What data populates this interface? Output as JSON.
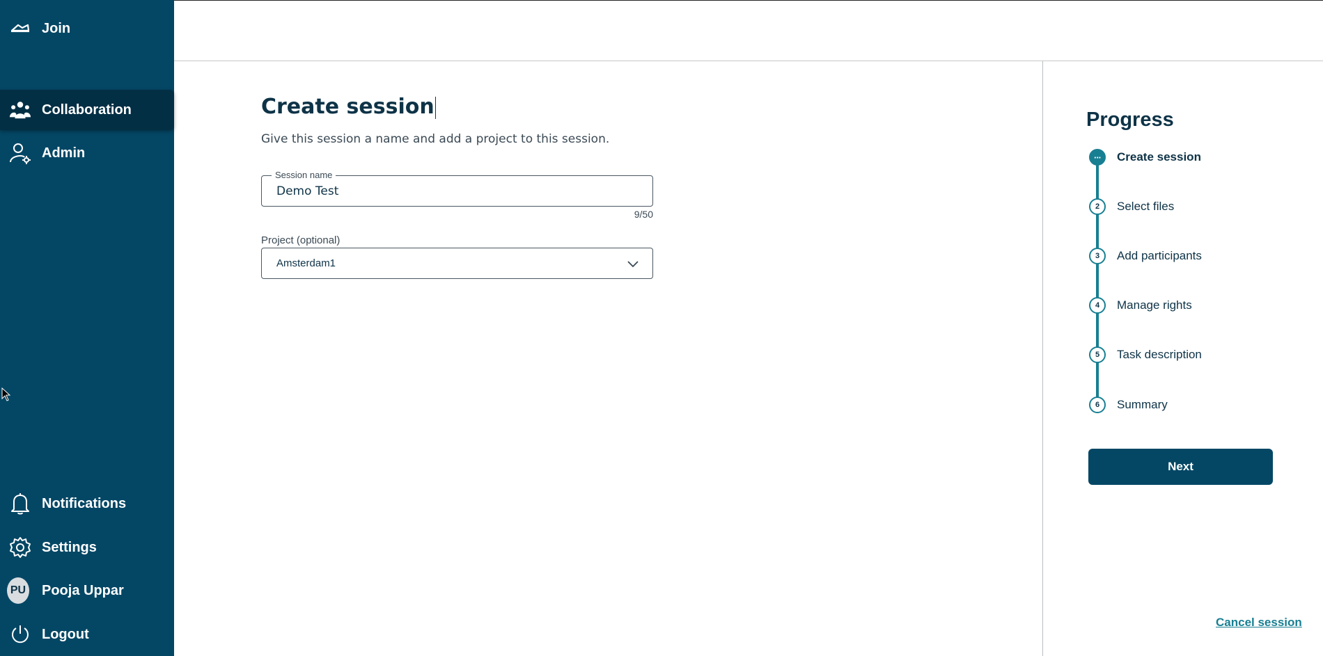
{
  "sidebar": {
    "top_items": [
      {
        "label": "Join",
        "icon": "cloud-join-icon"
      },
      {
        "label": "Collaboration",
        "icon": "group-icon",
        "active": true
      },
      {
        "label": "Admin",
        "icon": "user-gear-icon"
      }
    ],
    "bottom_items": [
      {
        "label": "Notifications",
        "icon": "bell-icon"
      },
      {
        "label": "Settings",
        "icon": "gear-icon"
      },
      {
        "label": "Pooja Uppar",
        "icon": "avatar",
        "initials": "PU"
      },
      {
        "label": "Logout",
        "icon": "power-icon"
      }
    ]
  },
  "main": {
    "title": "Create session",
    "subtitle": "Give this session a name and add a project to this session.",
    "session_name": {
      "legend": "Session name",
      "value": "Demo Test",
      "counter": "9/50"
    },
    "project": {
      "label": "Project (optional)",
      "selected": "Amsterdam1"
    }
  },
  "progress": {
    "title": "Progress",
    "steps": [
      {
        "number": "···",
        "label": "Create session",
        "active": true
      },
      {
        "number": "2",
        "label": "Select files"
      },
      {
        "number": "3",
        "label": "Add participants"
      },
      {
        "number": "4",
        "label": "Manage rights"
      },
      {
        "number": "5",
        "label": "Task description"
      },
      {
        "number": "6",
        "label": "Summary"
      }
    ],
    "next_label": "Next",
    "cancel_label": "Cancel session"
  },
  "colors": {
    "sidebar_bg": "#044765",
    "accent": "#187f92",
    "text_dark": "#0e3347"
  }
}
